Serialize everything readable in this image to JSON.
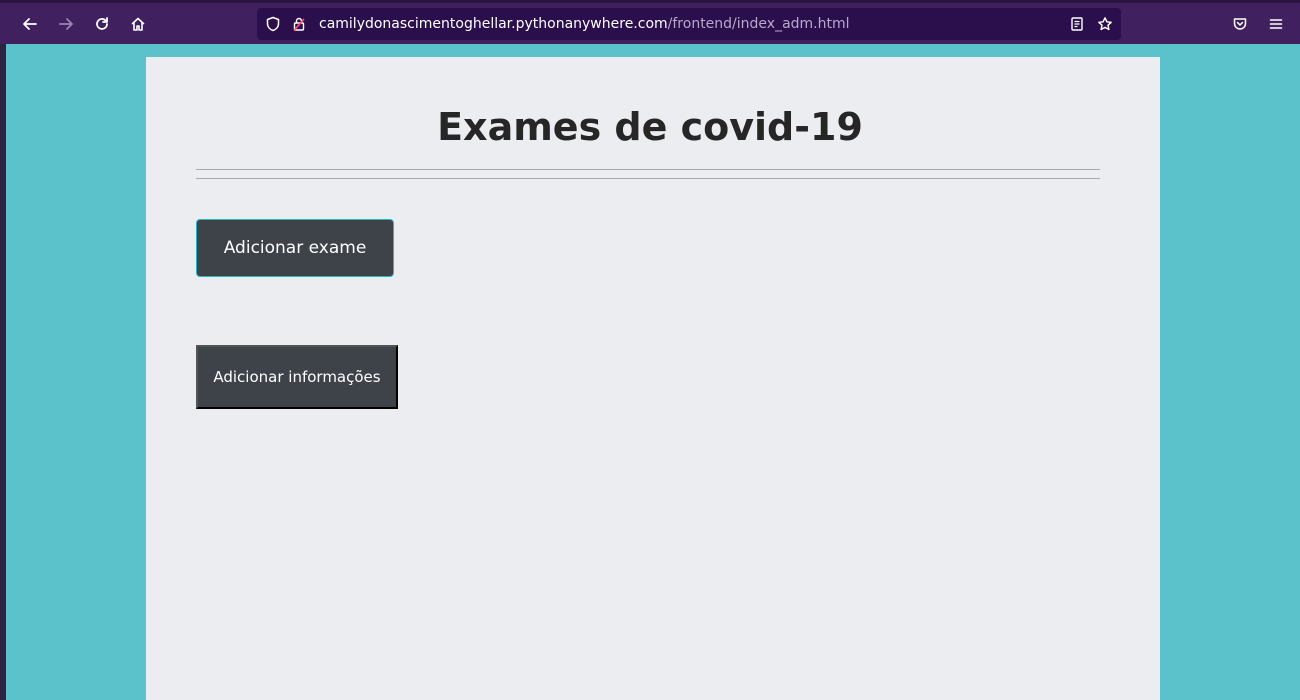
{
  "browser": {
    "url_domain": "camilydonascimentoghellar.pythonanywhere.com",
    "url_path": "/frontend/index_adm.html",
    "icons": [
      "back-icon",
      "forward-icon",
      "reload-icon",
      "home-icon",
      "shield-icon",
      "lock-icon",
      "reader-view-icon",
      "bookmark-star-icon",
      "pocket-icon",
      "menu-icon"
    ]
  },
  "colors": {
    "toolbar": "#40205e",
    "urlbar": "#2b0f4d",
    "page_background": "#5bc2cc",
    "card": "#ecedf0",
    "button": "#3e434a",
    "focus_border": "#2bb3c0"
  },
  "page": {
    "title": "Exames de covid-19",
    "buttons": {
      "add_exam": "Adicionar exame",
      "add_info": "Adicionar informações"
    }
  }
}
